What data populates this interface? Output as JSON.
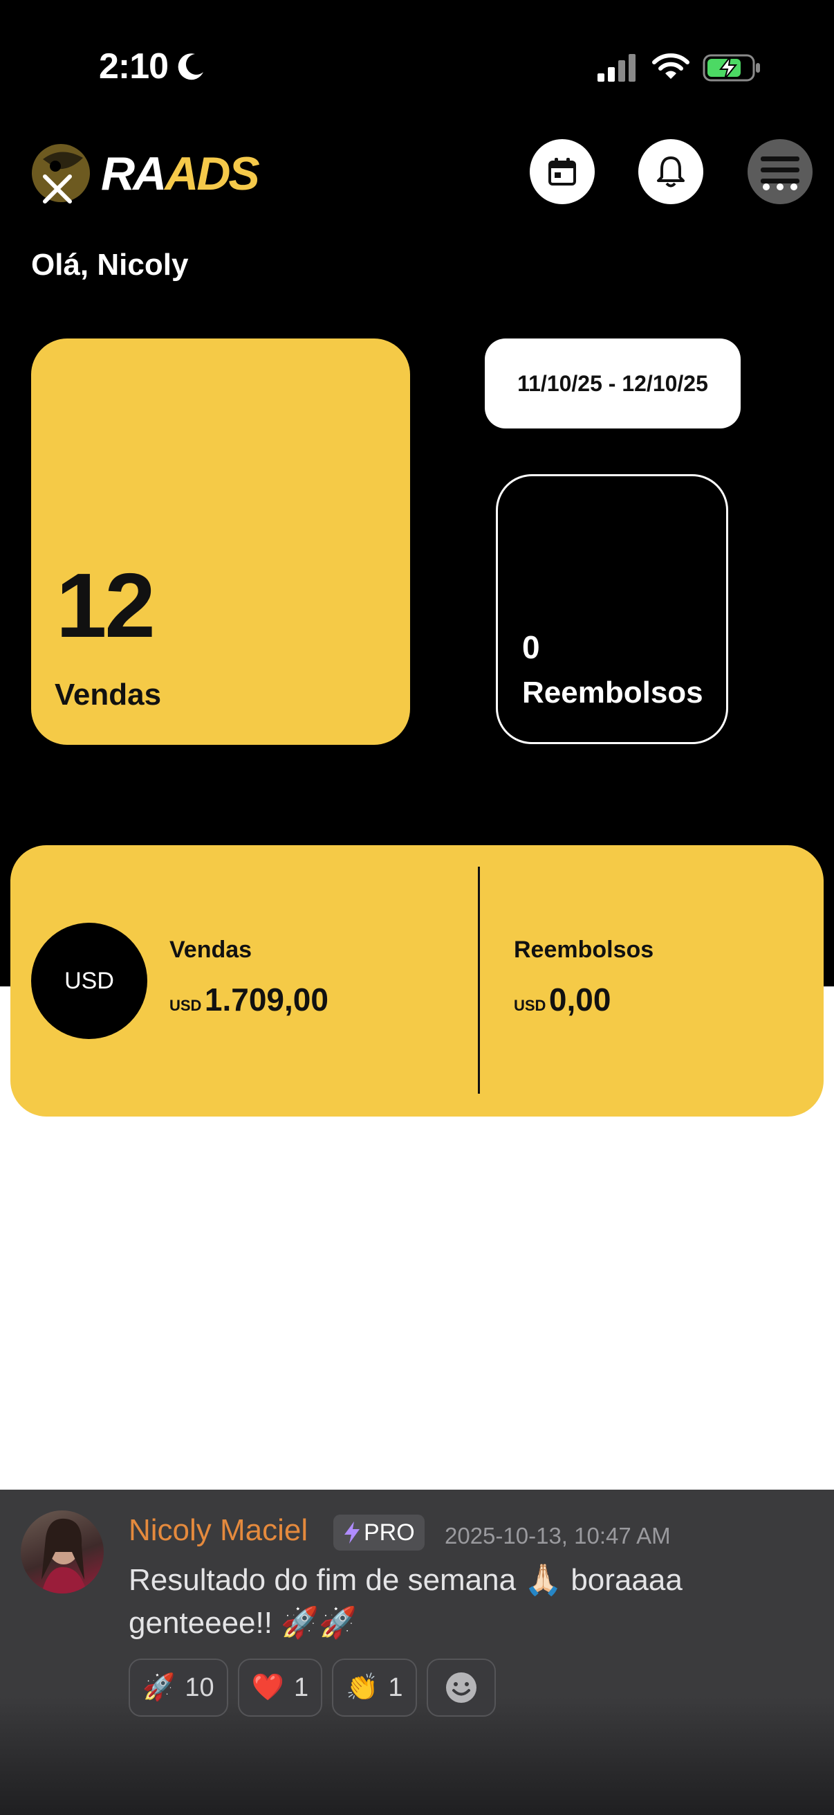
{
  "status_bar": {
    "time": "2:10"
  },
  "header": {
    "logo_white": "RA",
    "logo_yellow": "ADS",
    "greeting": "Olá, Nicoly"
  },
  "summary": {
    "sales_count": "12",
    "sales_label": "Vendas",
    "date_range": "11/10/25 - 12/10/25",
    "refund_count": "0",
    "refund_label": "Reembolsos"
  },
  "totals": {
    "currency_badge": "USD",
    "sales_label": "Vendas",
    "sales_currency": "USD",
    "sales_amount": "1.709,00",
    "refund_label": "Reembolsos",
    "refund_currency": "USD",
    "refund_amount": "0,00"
  },
  "message": {
    "author": "Nicoly Maciel",
    "badge": "PRO",
    "timestamp": "2025-10-13, 10:47 AM",
    "text_line1": "Resultado do fim de semana 🙏🏻 boraaaa",
    "text_line2": "genteeee!! 🚀🚀",
    "reactions": [
      {
        "emoji": "🚀",
        "count": "10"
      },
      {
        "emoji": "❤️",
        "count": "1"
      },
      {
        "emoji": "👏",
        "count": "1"
      }
    ],
    "add_reaction_icon": "smiley-plus-icon"
  },
  "colors": {
    "accent_yellow": "#f5ca47",
    "author_orange": "#e58a3d",
    "background_dark": "#000000"
  }
}
